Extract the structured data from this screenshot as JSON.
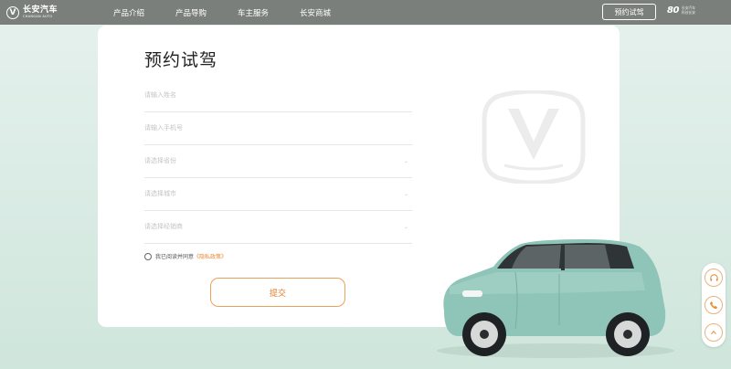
{
  "header": {
    "logo_cn": "长安汽车",
    "logo_en": "CHANGAN AUTO",
    "nav": [
      "产品介绍",
      "产品导购",
      "车主服务",
      "长安商城"
    ],
    "cta_label": "预约试驾",
    "brand_mark": "80",
    "brand_line1": "长安汽车",
    "brand_line2": "科技长安"
  },
  "form": {
    "title": "预约试驾",
    "name_placeholder": "请输入姓名",
    "phone_placeholder": "请输入手机号",
    "province_placeholder": "请选择省份",
    "city_placeholder": "请选择城市",
    "dealer_placeholder": "请选择经销商",
    "agree_prefix": "我已阅读并同意",
    "policy_link": "《隐私政策》",
    "submit_label": "提交"
  },
  "colors": {
    "accent": "#e88a35",
    "topbar": "#7b7f7c",
    "car_body": "#8fc4b8"
  }
}
